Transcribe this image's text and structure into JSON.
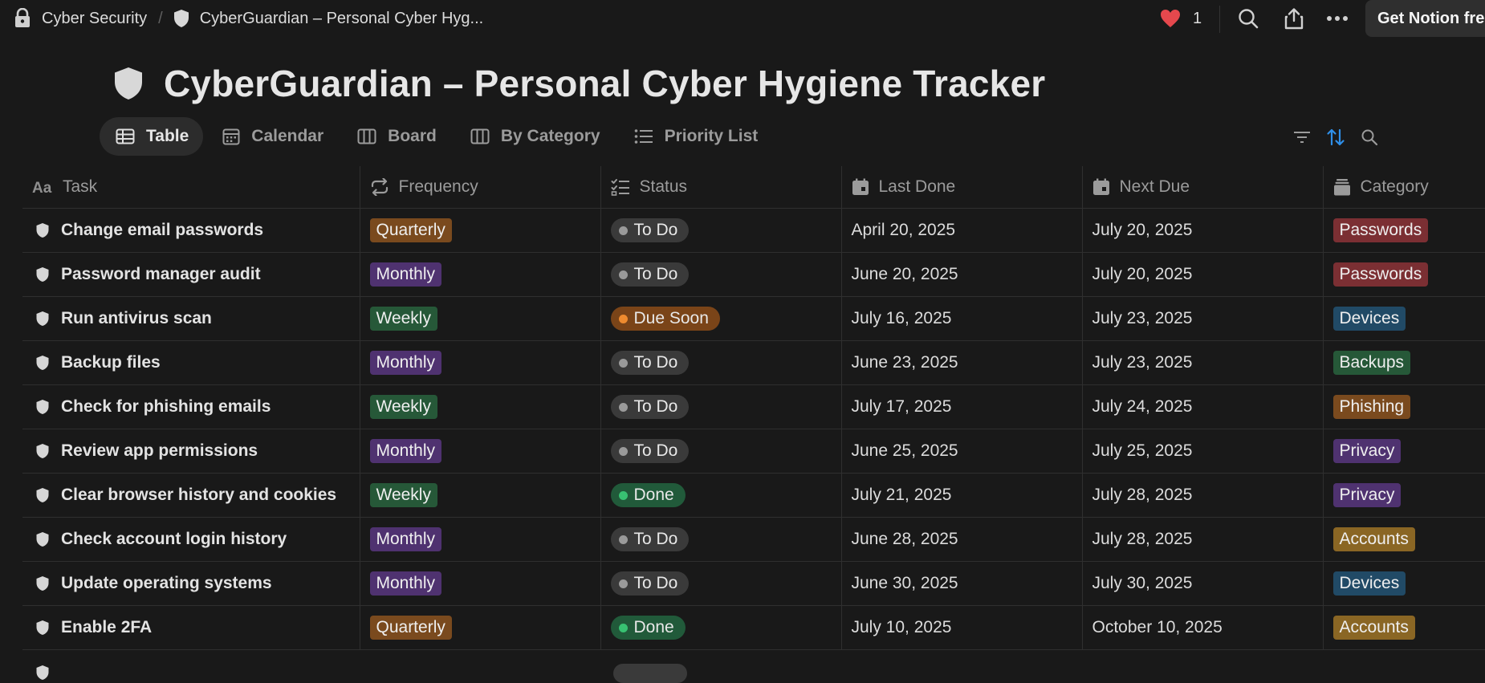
{
  "breadcrumb": {
    "workspace": "Cyber Security",
    "separator": "/",
    "page": "CyberGuardian – Personal Cyber Hyg..."
  },
  "topbar": {
    "likes": "1",
    "cta_label": "Get Notion free"
  },
  "page": {
    "title": "CyberGuardian – Personal Cyber Hygiene Tracker"
  },
  "views": [
    {
      "label": "Table",
      "icon": "table-icon",
      "active": true
    },
    {
      "label": "Calendar",
      "icon": "calendar-icon",
      "active": false
    },
    {
      "label": "Board",
      "icon": "board-icon",
      "active": false
    },
    {
      "label": "By Category",
      "icon": "board-icon",
      "active": false
    },
    {
      "label": "Priority List",
      "icon": "list-icon",
      "active": false
    }
  ],
  "columns": [
    {
      "label": "Task",
      "icon": "text-property-icon"
    },
    {
      "label": "Frequency",
      "icon": "repeat-icon"
    },
    {
      "label": "Status",
      "icon": "checklist-icon"
    },
    {
      "label": "Last Done",
      "icon": "calendar-date-icon"
    },
    {
      "label": "Next Due",
      "icon": "calendar-date-icon"
    },
    {
      "label": "Category",
      "icon": "archive-icon"
    }
  ],
  "colors": {
    "freq": {
      "Quarterly": "#7a4a1e",
      "Monthly": "#4f3270",
      "Weekly": "#265838"
    },
    "status_bg": {
      "To Do": "#3a3a3a",
      "Due Soon": "#7a4418",
      "Done": "#215a3a"
    },
    "status_dot": {
      "To Do": "#9a9a9a",
      "Due Soon": "#ee8b2f",
      "Done": "#38c172"
    },
    "category": {
      "Passwords": "#7b2f33",
      "Devices": "#214a66",
      "Backups": "#265838",
      "Phishing": "#7a4a1e",
      "Privacy": "#4f3270",
      "Accounts": "#8a6624"
    }
  },
  "rows": [
    {
      "task": "Change email passwords",
      "frequency": "Quarterly",
      "status": "To Do",
      "last_done": "April 20, 2025",
      "next_due": "July 20, 2025",
      "category": "Passwords"
    },
    {
      "task": "Password manager audit",
      "frequency": "Monthly",
      "status": "To Do",
      "last_done": "June 20, 2025",
      "next_due": "July 20, 2025",
      "category": "Passwords"
    },
    {
      "task": "Run antivirus scan",
      "frequency": "Weekly",
      "status": "Due Soon",
      "last_done": "July 16, 2025",
      "next_due": "July 23, 2025",
      "category": "Devices"
    },
    {
      "task": "Backup files",
      "frequency": "Monthly",
      "status": "To Do",
      "last_done": "June 23, 2025",
      "next_due": "July 23, 2025",
      "category": "Backups"
    },
    {
      "task": "Check for phishing emails",
      "frequency": "Weekly",
      "status": "To Do",
      "last_done": "July 17, 2025",
      "next_due": "July 24, 2025",
      "category": "Phishing"
    },
    {
      "task": "Review app permissions",
      "frequency": "Monthly",
      "status": "To Do",
      "last_done": "June 25, 2025",
      "next_due": "July 25, 2025",
      "category": "Privacy"
    },
    {
      "task": "Clear browser history and cookies",
      "frequency": "Weekly",
      "status": "Done",
      "last_done": "July 21, 2025",
      "next_due": "July 28, 2025",
      "category": "Privacy"
    },
    {
      "task": "Check account login history",
      "frequency": "Monthly",
      "status": "To Do",
      "last_done": "June 28, 2025",
      "next_due": "July 28, 2025",
      "category": "Accounts"
    },
    {
      "task": "Update operating systems",
      "frequency": "Monthly",
      "status": "To Do",
      "last_done": "June 30, 2025",
      "next_due": "July 30, 2025",
      "category": "Devices"
    },
    {
      "task": "Enable 2FA",
      "frequency": "Quarterly",
      "status": "Done",
      "last_done": "July 10, 2025",
      "next_due": "October 10, 2025",
      "category": "Accounts"
    }
  ]
}
